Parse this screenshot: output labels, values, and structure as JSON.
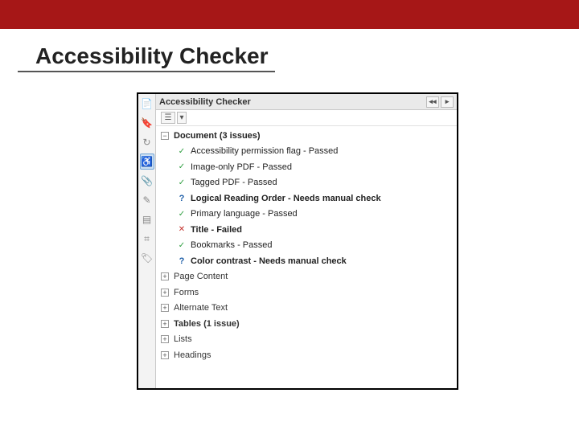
{
  "slide": {
    "title": "Accessibility Checker"
  },
  "panel": {
    "title": "Accessibility Checker",
    "opt_glyph": "☰",
    "dd_glyph": "▾",
    "collapse_glyph": "◂◂",
    "close_glyph": "▸"
  },
  "toolbar": {
    "items": [
      {
        "glyph": "📄",
        "name": "pages-icon"
      },
      {
        "glyph": "🔖",
        "name": "bookmarks-icon"
      },
      {
        "glyph": "↻",
        "name": "refresh-icon"
      },
      {
        "glyph": "♿",
        "name": "accessibility-icon",
        "selected": true
      },
      {
        "glyph": "📎",
        "name": "attachments-icon"
      },
      {
        "glyph": "✎",
        "name": "sign-icon"
      },
      {
        "glyph": "▤",
        "name": "layers-icon"
      },
      {
        "glyph": "⌗",
        "name": "model-tree-icon"
      },
      {
        "glyph": "🏷",
        "name": "tags-icon"
      }
    ]
  },
  "tree": {
    "doc_header": "Document (3 issues)",
    "items": [
      {
        "status": "pass",
        "bold": false,
        "label": "Accessibility permission flag - Passed"
      },
      {
        "status": "pass",
        "bold": false,
        "label": "Image-only PDF - Passed"
      },
      {
        "status": "pass",
        "bold": false,
        "label": "Tagged PDF - Passed"
      },
      {
        "status": "info",
        "bold": true,
        "label": "Logical Reading Order - Needs manual check"
      },
      {
        "status": "pass",
        "bold": false,
        "label": "Primary language - Passed"
      },
      {
        "status": "fail",
        "bold": true,
        "label": "Title - Failed"
      },
      {
        "status": "pass",
        "bold": false,
        "label": "Bookmarks - Passed"
      },
      {
        "status": "info",
        "bold": true,
        "label": "Color contrast - Needs manual check"
      }
    ],
    "categories": [
      {
        "bold": false,
        "label": "Page Content"
      },
      {
        "bold": false,
        "label": "Forms"
      },
      {
        "bold": false,
        "label": "Alternate Text"
      },
      {
        "bold": true,
        "label": "Tables (1 issue)"
      },
      {
        "bold": false,
        "label": "Lists"
      },
      {
        "bold": false,
        "label": "Headings"
      }
    ]
  },
  "glyph": {
    "pass": "✓",
    "fail": "✕",
    "info": "?",
    "minus": "−",
    "plus": "+"
  }
}
